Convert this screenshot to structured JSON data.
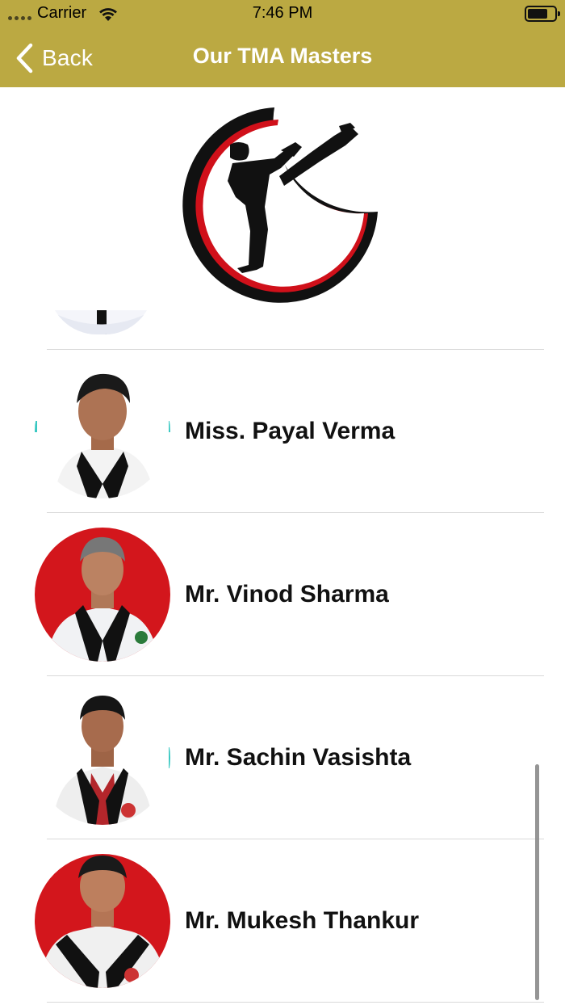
{
  "status_bar": {
    "carrier": "Carrier",
    "time": "7:46 PM"
  },
  "nav": {
    "back_label": "Back",
    "title": "Our TMA Masters"
  },
  "colors": {
    "header_bg": "#bba942",
    "header_text": "#ffffff",
    "logo_red": "#d0101a",
    "avatar_red": "#d3161c"
  },
  "masters": [
    {
      "name": "Miss. Payal Verma",
      "avatar_bg": "white"
    },
    {
      "name": "Mr. Vinod Sharma",
      "avatar_bg": "red"
    },
    {
      "name": "Mr. Sachin Vasishta",
      "avatar_bg": "white"
    },
    {
      "name": "Mr. Mukesh Thankur",
      "avatar_bg": "red"
    }
  ]
}
